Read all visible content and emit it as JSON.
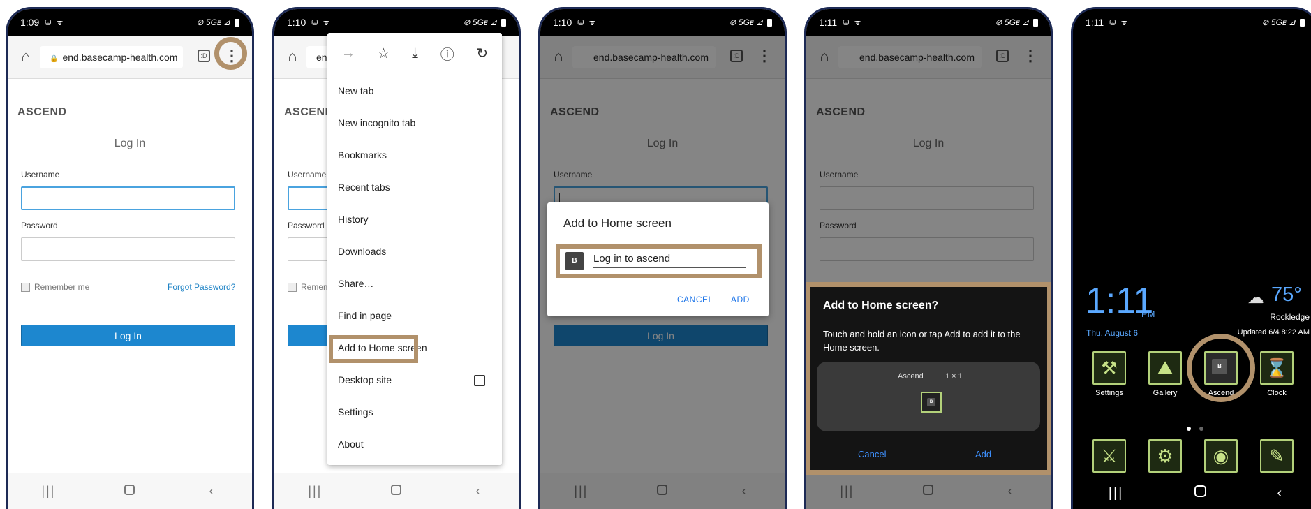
{
  "status": {
    "p1": {
      "time": "1:09",
      "icons": "⛁ ᯤ",
      "right": "⊘ 5Gᴇ ⊿"
    },
    "p2": {
      "time": "1:10",
      "icons": "⛁ ᯤ",
      "right": "⊘ 5Gᴇ ⊿"
    },
    "p3": {
      "time": "1:10",
      "icons": "⛁ ᯤ",
      "right": "⊘ 5Gᴇ ⊿"
    },
    "p4": {
      "time": "1:11",
      "icons": "⛁ ᯤ",
      "right": "⊘ 5Gᴇ ⊿"
    },
    "p5": {
      "time": "1:11",
      "icons": "⛁ ᯤ",
      "right": "⊘ 5Gᴇ ⊿"
    }
  },
  "browser": {
    "url": "end.basecamp-health.com",
    "url_short": "en",
    "tabs_count": ":D",
    "home_icon": "⌂",
    "menu_icon": "⋮",
    "lock_icon": "🔒"
  },
  "login": {
    "brand": "ASCEND",
    "title": "Log In",
    "username_label": "Username",
    "password_label": "Password",
    "remember": "Remember me",
    "remember_short": "Remembe",
    "forgot": "Forgot Password?",
    "button": "Log In"
  },
  "menu": {
    "icons": [
      "→",
      "☆",
      "⤓",
      "ⓘ",
      "↻"
    ],
    "items": [
      "New tab",
      "New incognito tab",
      "Bookmarks",
      "Recent tabs",
      "History",
      "Downloads",
      "Share…",
      "Find in page",
      "Add to Home screen",
      "Desktop site",
      "Settings",
      "About"
    ]
  },
  "dialog3": {
    "title": "Add to Home screen",
    "icon_letter": "B",
    "name_value": "Log in to ascend",
    "cancel": "CANCEL",
    "add": "ADD"
  },
  "sheet4": {
    "title": "Add to Home screen?",
    "description": "Touch and hold an icon or tap Add to add it to the Home screen.",
    "app_name": "Ascend",
    "size": "1 × 1",
    "icon_letter": "B",
    "cancel": "Cancel",
    "add": "Add"
  },
  "home5": {
    "time": "1:11",
    "ampm": "PM",
    "date": "Thu, August 6",
    "temp": "75°",
    "location": "Rockledge",
    "updated": "Updated 6/4 8:22 AM",
    "weather_icon": "☁",
    "apps_row1": [
      {
        "label": "Settings",
        "icon": "⚒"
      },
      {
        "label": "Gallery",
        "icon": "⛰"
      },
      {
        "label": "Ascend",
        "icon": "B"
      },
      {
        "label": "Clock",
        "icon": "⌛"
      }
    ],
    "apps_row2": [
      {
        "icon": "⚔"
      },
      {
        "icon": "⚙"
      },
      {
        "icon": "◉"
      },
      {
        "icon": "✎"
      }
    ]
  },
  "nav": {
    "recent": "|||",
    "back": "‹"
  },
  "colors": {
    "highlight": "#b1916b",
    "accent": "#1d87cf",
    "link": "#2184c6",
    "samsung_blue": "#5aa8ff"
  }
}
